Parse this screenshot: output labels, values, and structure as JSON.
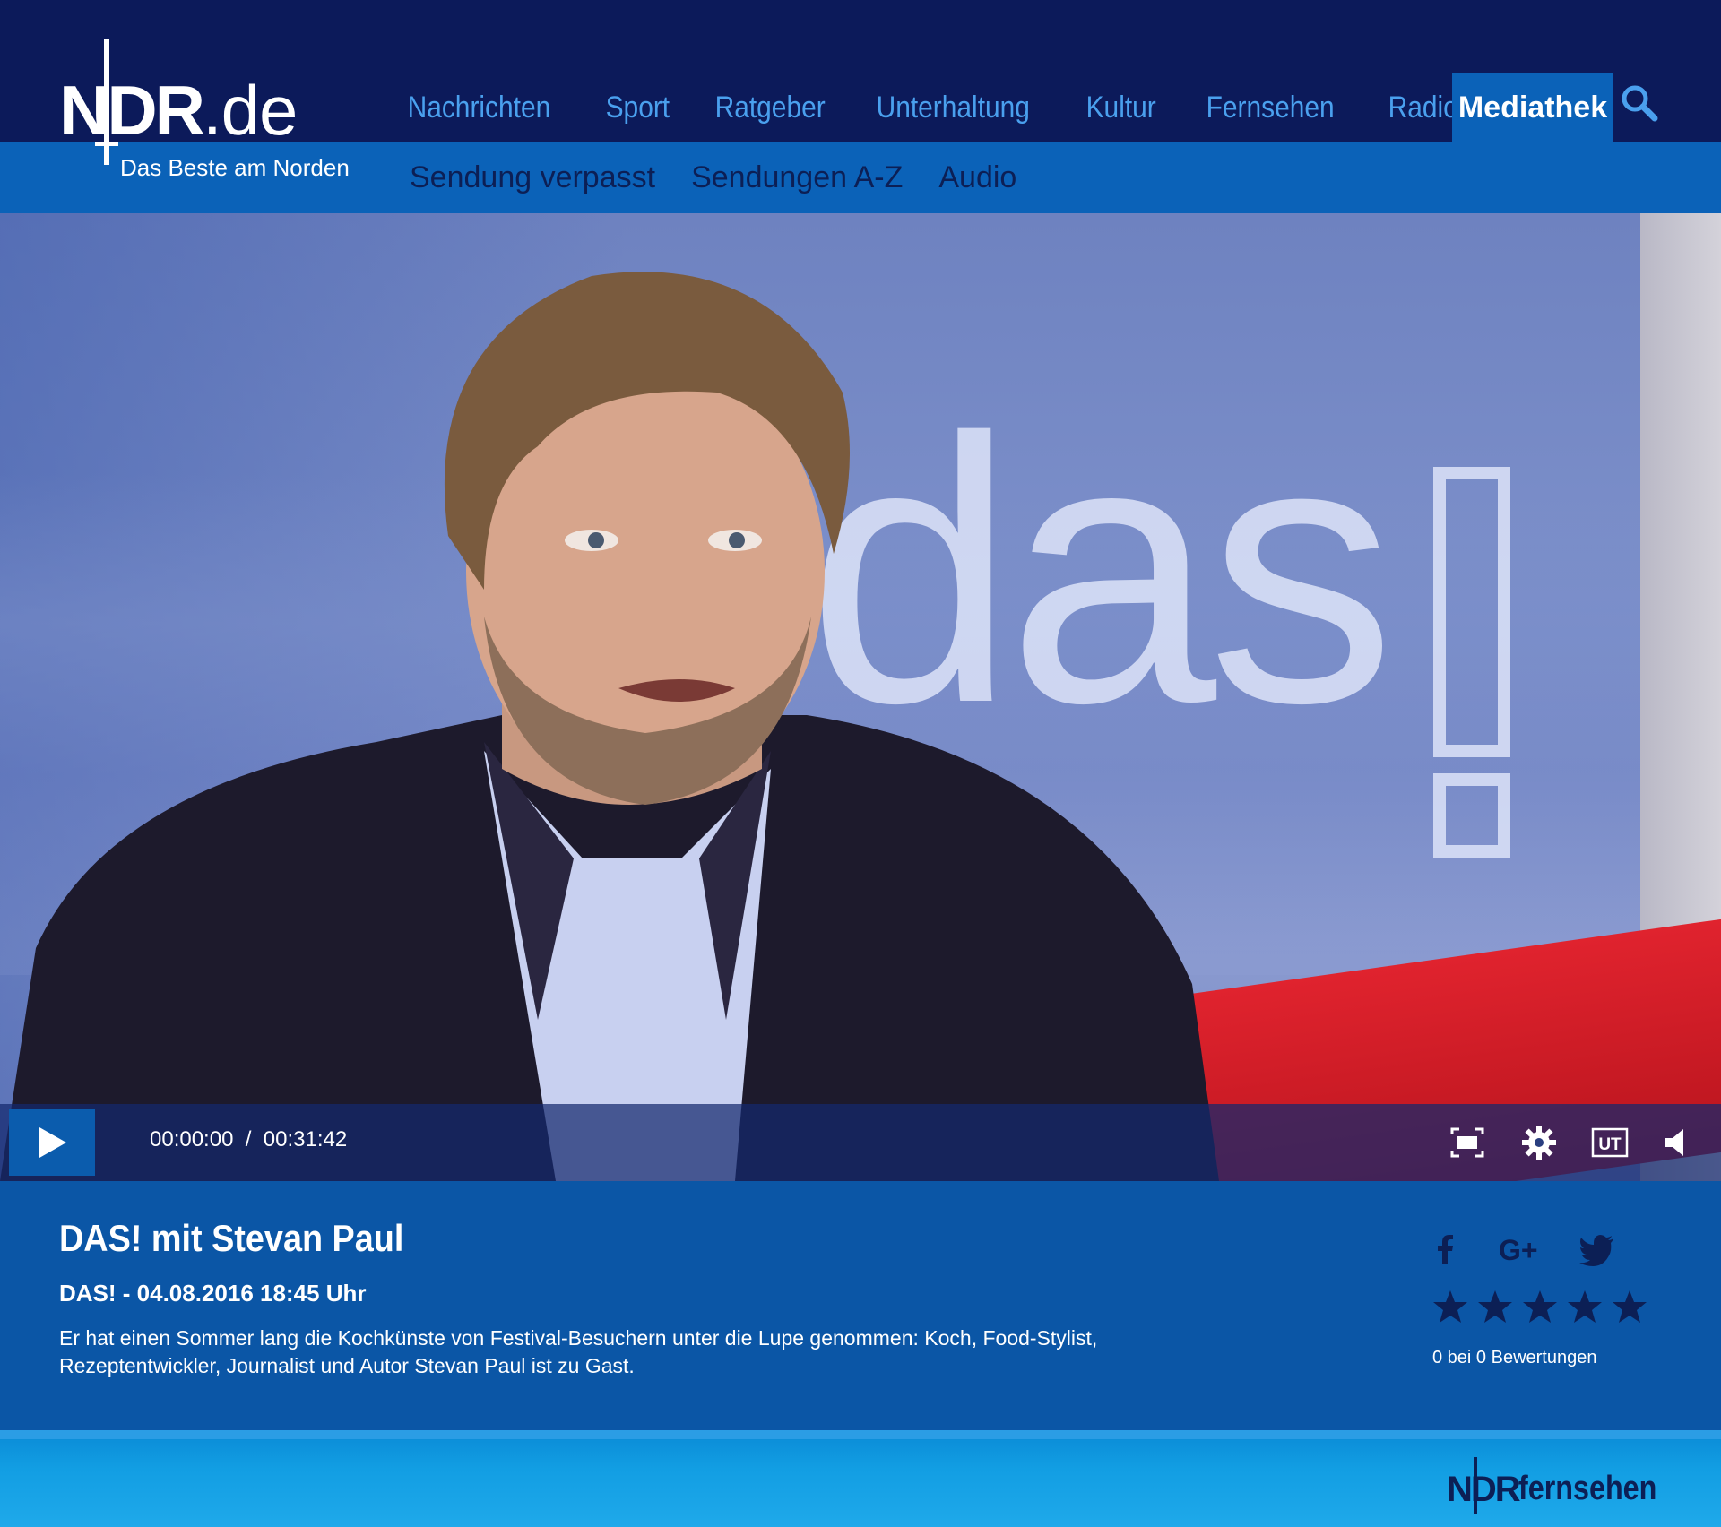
{
  "brand": {
    "logo_main": "NDR",
    "logo_suffix": ".de",
    "claim": "Das Beste am Norden"
  },
  "nav": {
    "left": [
      "Nachrichten",
      "Sport",
      "Ratgeber",
      "Unterhaltung",
      "Kultur"
    ],
    "right": [
      "Fernsehen",
      "Radio"
    ],
    "active": "Mediathek",
    "search_icon": "search-icon"
  },
  "subnav": [
    "Sendung verpasst",
    "Sendungen A-Z",
    "Audio"
  ],
  "video": {
    "backdrop_text": "das",
    "current_time": "00:00:00",
    "separator": "/",
    "duration": "00:31:42",
    "controls": [
      "fullscreen-icon",
      "settings-icon",
      "subtitles-icon",
      "volume-icon"
    ],
    "subtitles_label": "UT"
  },
  "info": {
    "title": "DAS! mit Stevan Paul",
    "meta": "DAS! - 04.08.2016 18:45 Uhr",
    "description": "Er hat einen Sommer lang die Kochkünste von Festival-Besuchern unter die Lupe genommen: Koch, Food-Stylist, Rezeptentwickler, Journalist und Autor Stevan Paul ist zu Gast.",
    "share": [
      "facebook-icon",
      "google-plus-icon",
      "twitter-icon"
    ],
    "rating": {
      "stars_total": 5,
      "stars_filled": 0,
      "text": "0 bei 0 Bewertungen"
    }
  },
  "footer": {
    "logo_ndr": "NDR",
    "logo_channel": "fernsehen"
  },
  "colors": {
    "top_bar": "#0c1a5a",
    "sub_bar": "#0b62b8",
    "nav_link": "#4aa0ee",
    "info_bg": "#0b56a6",
    "footer_bg": "#129ee3"
  }
}
